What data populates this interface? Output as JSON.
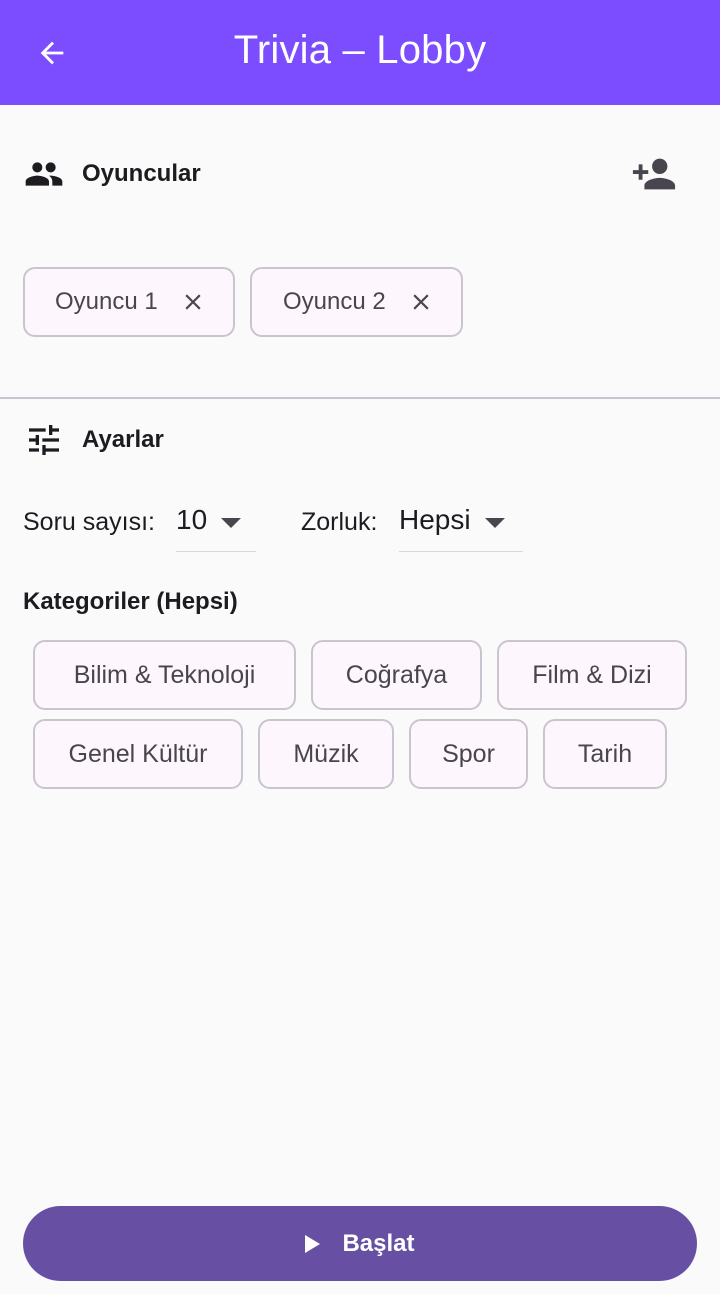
{
  "appbar": {
    "title": "Trivia – Lobby",
    "color": "#7c4dff",
    "back_icon": "arrow-back-icon"
  },
  "players_section": {
    "title": "Oyuncular",
    "icon": "group-icon",
    "add_icon": "person-add-icon",
    "players": [
      {
        "name": "Oyuncu 1"
      },
      {
        "name": "Oyuncu 2"
      }
    ]
  },
  "settings_section": {
    "title": "Ayarlar",
    "icon": "tune-icon",
    "question_count": {
      "label": "Soru sayısı:",
      "value": "10"
    },
    "difficulty": {
      "label": "Zorluk:",
      "value": "Hepsi"
    }
  },
  "categories": {
    "title": "Kategoriler (Hepsi)",
    "items": [
      "Bilim & Teknoloji",
      "Coğrafya",
      "Film & Dizi",
      "Genel Kültür",
      "Müzik",
      "Spor",
      "Tarih"
    ]
  },
  "start_button": {
    "label": "Başlat",
    "icon": "play-icon",
    "color": "#6750a4"
  }
}
